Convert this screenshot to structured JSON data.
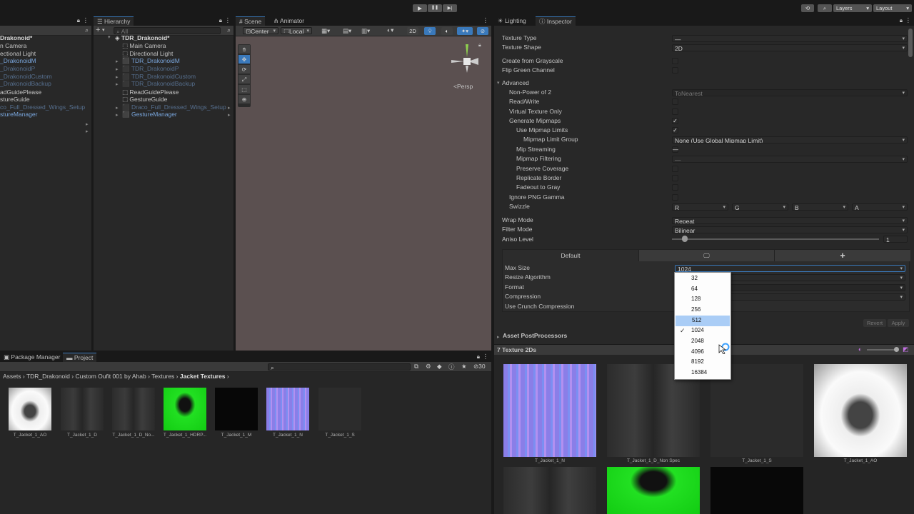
{
  "colors": {
    "accent": "#3a79bb",
    "selection_blue": "#7aa7de",
    "panel": "#282828"
  },
  "toolbar": {
    "play_icon": "▶",
    "pause_icon": "❚❚",
    "step_icon": "▶|",
    "layers_label": "Layers",
    "layout_label": "Layout"
  },
  "left_panel": {
    "items": [
      {
        "label": "Drakonoid*"
      },
      {
        "label": "n Camera"
      },
      {
        "label": "ectional Light"
      },
      {
        "label": "_DrakonoidM"
      },
      {
        "label": "_DrakonoidP"
      },
      {
        "label": "_DrakonoidCustom"
      },
      {
        "label": "_DrakonoidBackup"
      },
      {
        "label": "adGuidePlease"
      },
      {
        "label": "stureGuide"
      },
      {
        "label": "co_Full_Dressed_Wings_Setup"
      },
      {
        "label": "stureManager"
      }
    ]
  },
  "hierarchy": {
    "tab_label": "Hierarchy",
    "search_placeholder": "All",
    "add_label": "+",
    "scene_name": "TDR_Drakonoid*",
    "items": [
      {
        "label": "Main Camera"
      },
      {
        "label": "Directional Light"
      },
      {
        "label": "TDR_DrakonoidM"
      },
      {
        "label": "TDR_DrakonoidP"
      },
      {
        "label": "TDR_DrakonoidCustom"
      },
      {
        "label": "TDR_DrakonoidBackup"
      },
      {
        "label": "ReadGuidePlease"
      },
      {
        "label": "GestureGuide"
      },
      {
        "label": "Draco_Full_Dressed_Wings_Setup"
      },
      {
        "label": "GestureManager"
      }
    ]
  },
  "scene": {
    "tab_scene": "Scene",
    "tab_animator": "Animator",
    "pivot_label": "Center",
    "space_label": "Local",
    "mode_2d": "2D",
    "persp_label": "Persp"
  },
  "inspector": {
    "tab_lighting": "Lighting",
    "tab_inspector": "Inspector",
    "texture_type_label": "Texture Type",
    "texture_type_value": "—",
    "texture_shape_label": "Texture Shape",
    "texture_shape_value": "2D",
    "create_grayscale_label": "Create from Grayscale",
    "flip_green_label": "Flip Green Channel",
    "advanced_label": "Advanced",
    "npot_label": "Non-Power of 2",
    "npot_value": "ToNearest",
    "read_write_label": "Read/Write",
    "virtual_texture_label": "Virtual Texture Only",
    "generate_mipmaps_label": "Generate Mipmaps",
    "generate_mipmaps_check": "✓",
    "use_mipmap_limits_label": "Use Mipmap Limits",
    "use_mipmap_limits_check": "✓",
    "mipmap_limit_group_label": "Mipmap Limit Group",
    "mipmap_limit_group_value": "None (Use Global Mipmap Limit)",
    "mip_streaming_label": "Mip Streaming",
    "mip_streaming_check": "—",
    "mipmap_filtering_label": "Mipmap Filtering",
    "mipmap_filtering_value": "—",
    "preserve_coverage_label": "Preserve Coverage",
    "replicate_border_label": "Replicate Border",
    "fadeout_gray_label": "Fadeout to Gray",
    "ignore_png_gamma_label": "Ignore PNG Gamma",
    "swizzle_label": "Swizzle",
    "swizzle_r": "R",
    "swizzle_g": "G",
    "swizzle_b": "B",
    "swizzle_a": "A",
    "wrap_mode_label": "Wrap Mode",
    "wrap_mode_value": "Repeat",
    "filter_mode_label": "Filter Mode",
    "filter_mode_value": "Bilinear",
    "aniso_label": "Aniso Level",
    "aniso_value": "1",
    "aniso_level": 1,
    "platform_default_label": "Default",
    "max_size_label": "Max Size",
    "max_size_value": "1024",
    "resize_algorithm_label": "Resize Algorithm",
    "format_label": "Format",
    "compression_label": "Compression",
    "crunch_label": "Use Crunch Compression",
    "revert_label": "Revert",
    "apply_label": "Apply",
    "asset_postprocessors_label": "Asset PostProcessors"
  },
  "max_size_dropdown": {
    "options": [
      "32",
      "64",
      "128",
      "256",
      "512",
      "1024",
      "2048",
      "4096",
      "8192",
      "16384"
    ],
    "selected": "1024",
    "highlighted": "512",
    "check": "✓"
  },
  "preview": {
    "title": "7 Texture 2Ds",
    "items": [
      {
        "label": "T_Jacket_1_N"
      },
      {
        "label": "T_Jacket_1_D_Non Spec"
      },
      {
        "label": "T_Jacket_1_S"
      },
      {
        "label": "T_Jacket_1_AO"
      }
    ]
  },
  "project": {
    "tab_package_manager": "Package Manager",
    "tab_project": "Project",
    "count_label": "30",
    "breadcrumb": [
      "Assets",
      "TDR_Drakonoid",
      "Custom Oufit 001 by Ahab",
      "Textures",
      "Jacket Textures"
    ],
    "assets": [
      {
        "label": "T_Jacket_1_AO"
      },
      {
        "label": "T_Jacket_1_D"
      },
      {
        "label": "T_Jacket_1_D_No..."
      },
      {
        "label": "T_Jacket_1_HDRP..."
      },
      {
        "label": "T_Jacket_1_M"
      },
      {
        "label": "T_Jacket_1_N"
      },
      {
        "label": "T_Jacket_1_S"
      }
    ]
  }
}
